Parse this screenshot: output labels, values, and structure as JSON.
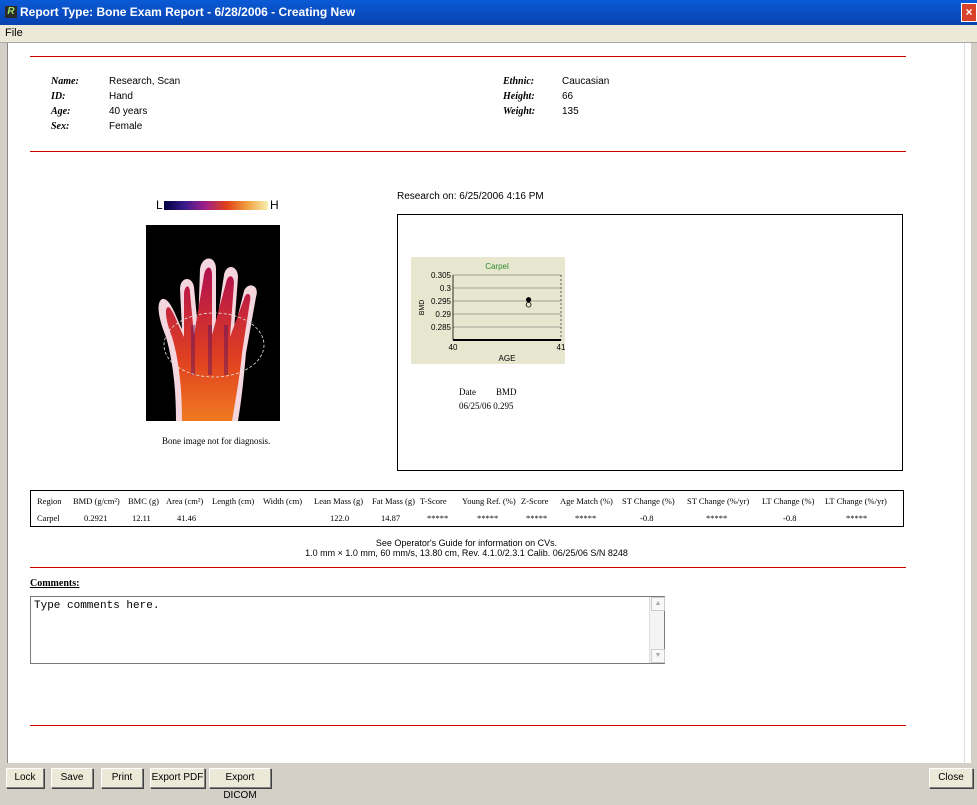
{
  "window": {
    "title": "Report Type: Bone Exam Report - 6/28/2006 - Creating New",
    "close_glyph": "×",
    "app_icon_glyph": "R"
  },
  "menu": {
    "file": "File"
  },
  "patient": {
    "name_label": "Name:",
    "name": "Research, Scan",
    "id_label": "ID:",
    "id": "Hand",
    "age_label": "Age:",
    "age": "40 years",
    "sex_label": "Sex:",
    "sex": "Female",
    "ethnic_label": "Ethnic:",
    "ethnic": "Caucasian",
    "height_label": "Height:",
    "height": "66",
    "weight_label": "Weight:",
    "weight": "135"
  },
  "colorbar": {
    "low": "L",
    "high": "H"
  },
  "image_caption": "Bone image not for diagnosis.",
  "research_on": "Research on: 6/25/2006 4:16 PM",
  "chart_data": {
    "type": "scatter",
    "title": "Carpel",
    "xlabel": "AGE",
    "ylabel": "BMD",
    "xlim": [
      40,
      41
    ],
    "ylim": [
      0.28,
      0.305
    ],
    "xticks": [
      "40",
      "41"
    ],
    "yticks": [
      "0.305",
      "0.3",
      "0.295",
      "0.29",
      "0.285"
    ],
    "ytick_values": [
      0.305,
      0.3,
      0.295,
      0.29,
      0.285
    ],
    "points": [
      {
        "x": 40.7,
        "y": 0.2955
      }
    ],
    "grid": true
  },
  "trend_table": {
    "date_header": "Date",
    "bmd_header": "BMD",
    "rows": [
      "06/25/06 0.295"
    ]
  },
  "results": {
    "headers": [
      "Region",
      "BMD (g/cm²)",
      "BMC (g)",
      "Area (cm²)",
      "Length (cm)",
      "Width (cm)",
      "Lean Mass (g)",
      "Fat Mass (g)",
      "T-Score",
      "Young Ref. (%)",
      "Z-Score",
      "Age Match (%)",
      "ST Change (%)",
      "ST Change (%/yr)",
      "LT Change (%)",
      "LT Change (%/yr)"
    ],
    "values": [
      "Carpel",
      "0.2921",
      "12.11",
      "41.46",
      "",
      "",
      "122.0",
      "14.87",
      "*****",
      "*****",
      "*****",
      "*****",
      "-0.8",
      "*****",
      "-0.8",
      "*****"
    ]
  },
  "notes": {
    "line1": "See Operator's Guide for information on CVs.",
    "line2": "1.0 mm × 1.0 mm, 60 mm/s, 13.80 cm, Rev. 4.1.0/2.3.1 Calib. 06/25/06 S/N 8248"
  },
  "comments": {
    "label": "Comments:",
    "text": "Type comments here.",
    "scroll_up": "▲",
    "scroll_down": "▼"
  },
  "buttons": {
    "lock": "Lock",
    "save": "Save",
    "print": "Print",
    "export_pdf": "Export PDF",
    "export_dicom": "Export DICOM",
    "close": "Close"
  },
  "colors": {
    "title_bar": "#0842b0",
    "separator": "#d40000",
    "chart_bg": "#e7e7d0",
    "chart_title": "#2a8a2a"
  }
}
